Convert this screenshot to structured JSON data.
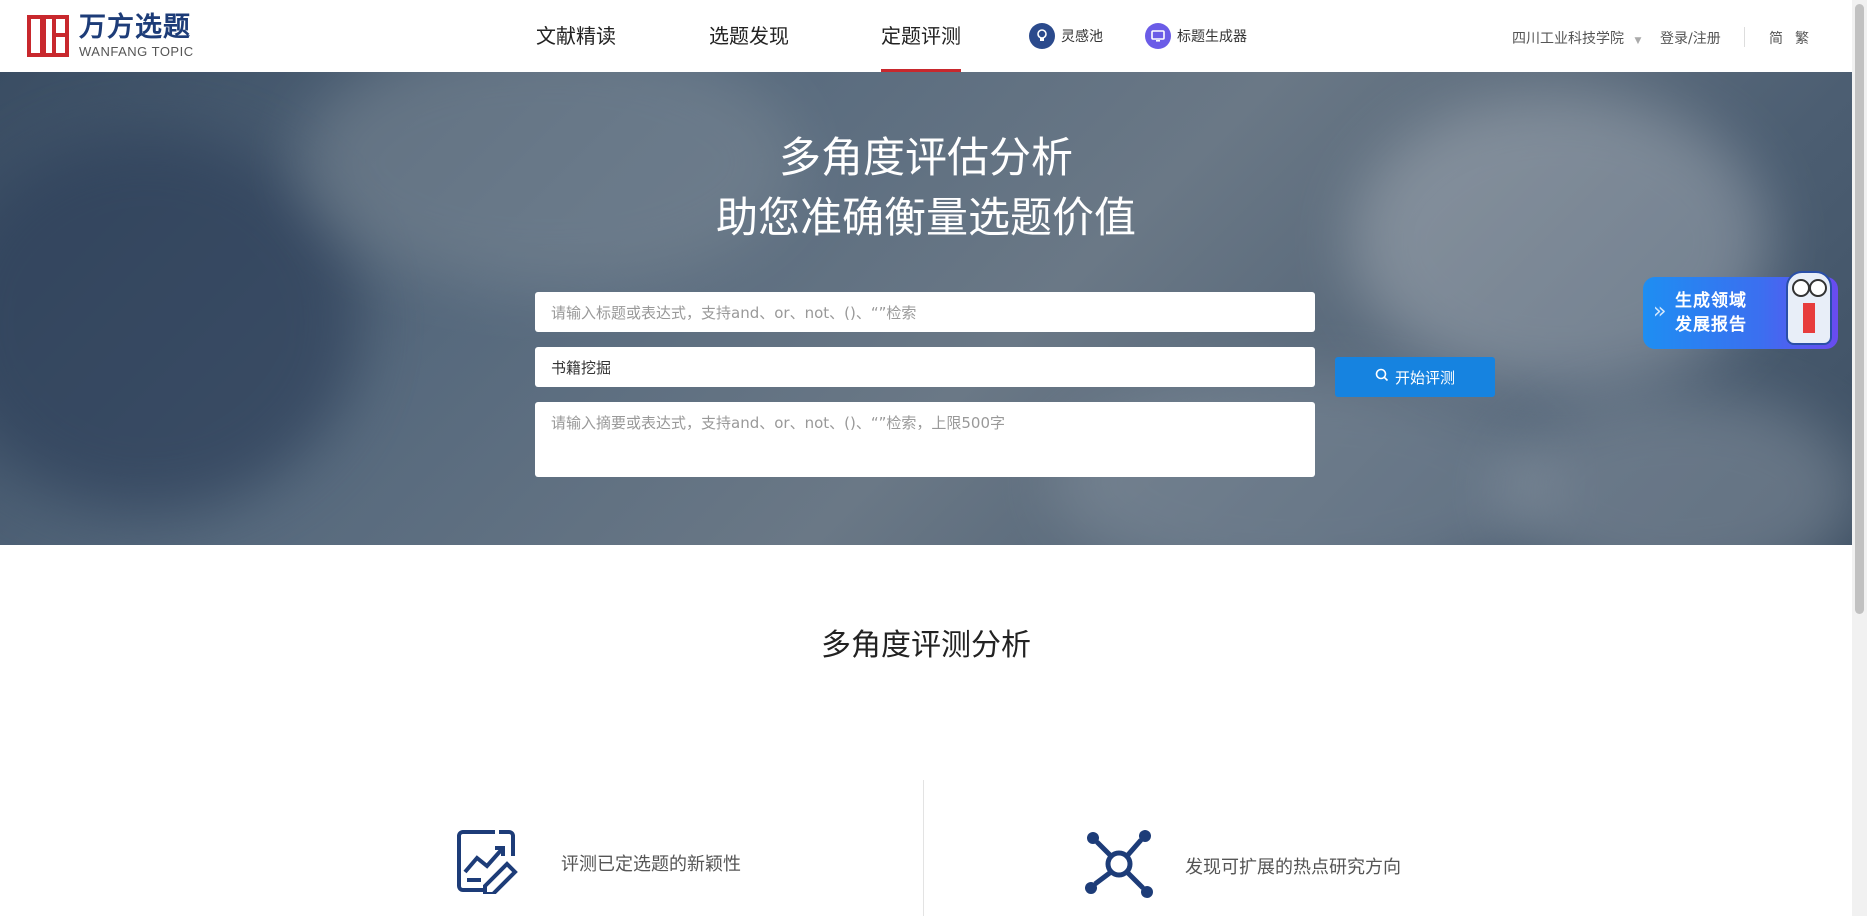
{
  "logo": {
    "cn": "万方选题",
    "en": "WANFANG TOPIC"
  },
  "nav": {
    "items": [
      {
        "label": "文献精读"
      },
      {
        "label": "选题发现"
      },
      {
        "label": "定题评测"
      }
    ],
    "active_index": 2,
    "tools": [
      {
        "label": "灵感池",
        "icon": "lightbulb-icon",
        "color": "#2b4a8c"
      },
      {
        "label": "标题生成器",
        "icon": "monitor-icon",
        "color": "#6b5ce7"
      }
    ]
  },
  "header_right": {
    "institution": "四川工业科技学院",
    "login": "登录/注册",
    "lang_simplified": "简",
    "lang_traditional": "繁"
  },
  "hero": {
    "title_line1": "多角度评估分析",
    "title_line2": "助您准确衡量选题价值",
    "title_input_placeholder": "请输入标题或表达式，支持and、or、not、()、“”检索",
    "keyword_input_value": "书籍挖掘",
    "abstract_input_placeholder": "请输入摘要或表达式，支持and、or、not、()、“”检索，上限500字",
    "eval_button": "开始评测"
  },
  "report_badge": {
    "line1": "生成领域",
    "line2": "发展报告"
  },
  "section": {
    "title": "多角度评测分析",
    "features": [
      {
        "label": "评测已定选题的新颖性",
        "icon": "chart-edit-icon"
      },
      {
        "label": "发现可扩展的热点研究方向",
        "icon": "network-icon"
      }
    ]
  },
  "colors": {
    "brand_red": "#c8282d",
    "brand_blue": "#1d3c78",
    "button_blue": "#1683e0"
  }
}
